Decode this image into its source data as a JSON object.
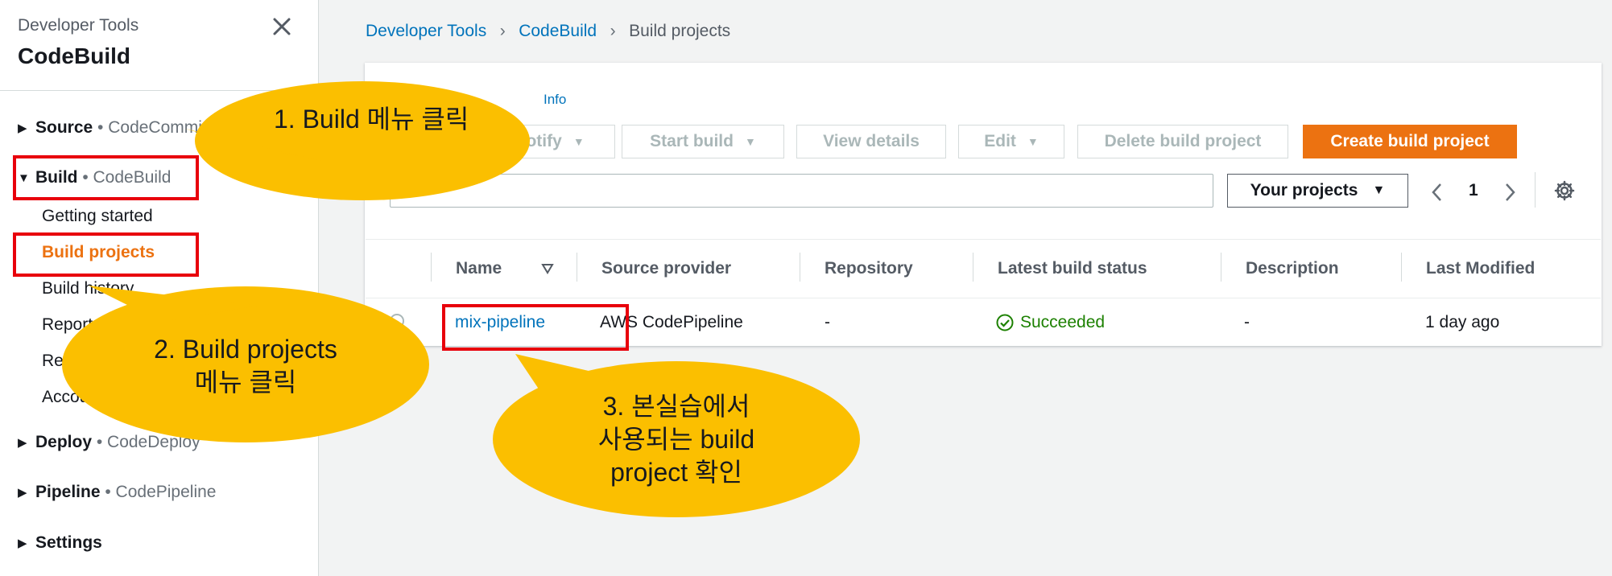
{
  "sidebar": {
    "service": "Developer Tools",
    "title": "CodeBuild",
    "groups": [
      {
        "name": "Source",
        "sub": " • CodeCommit",
        "caret": "▶"
      },
      {
        "name": "Build",
        "sub": " • CodeBuild",
        "caret": "▼"
      },
      {
        "name": "Deploy",
        "sub": " • CodeDeploy",
        "caret": "▶"
      },
      {
        "name": "Pipeline",
        "sub": " • CodePipeline",
        "caret": "▶"
      },
      {
        "name": "Settings",
        "sub": "",
        "caret": "▶"
      }
    ],
    "build_items": [
      "Getting started",
      "Build projects",
      "Build history",
      "Report groups",
      "Report history",
      "Account metrics"
    ]
  },
  "breadcrumb": {
    "items": [
      "Developer Tools",
      "CodeBuild",
      "Build projects"
    ],
    "sep": "›"
  },
  "panel": {
    "info": "Info",
    "buttons": {
      "notify": "Notify",
      "start_build": "Start build",
      "view_details": "View details",
      "edit": "Edit",
      "delete": "Delete build project",
      "create": "Create build project"
    },
    "filter": "Your projects",
    "page": "1"
  },
  "table": {
    "headers": [
      "Name",
      "Source provider",
      "Repository",
      "Latest build status",
      "Description",
      "Last Modified"
    ],
    "rows": [
      {
        "name": "mix-pipeline",
        "source": "AWS CodePipeline",
        "repo": "-",
        "status": "Succeeded",
        "description": "-",
        "modified": "1 day ago"
      }
    ]
  },
  "annotations": {
    "step1": "1. Build  메뉴 클릭",
    "step2": [
      "2. Build projects",
      "메뉴 클릭"
    ],
    "step3": [
      "3. 본실습에서",
      "사용되는 build",
      "project 확인"
    ]
  },
  "colors": {
    "accent": "#ec7211",
    "link": "#0073bb",
    "success": "#1d8102",
    "callout": "#fbbf00",
    "highlight": "#e8000b"
  }
}
